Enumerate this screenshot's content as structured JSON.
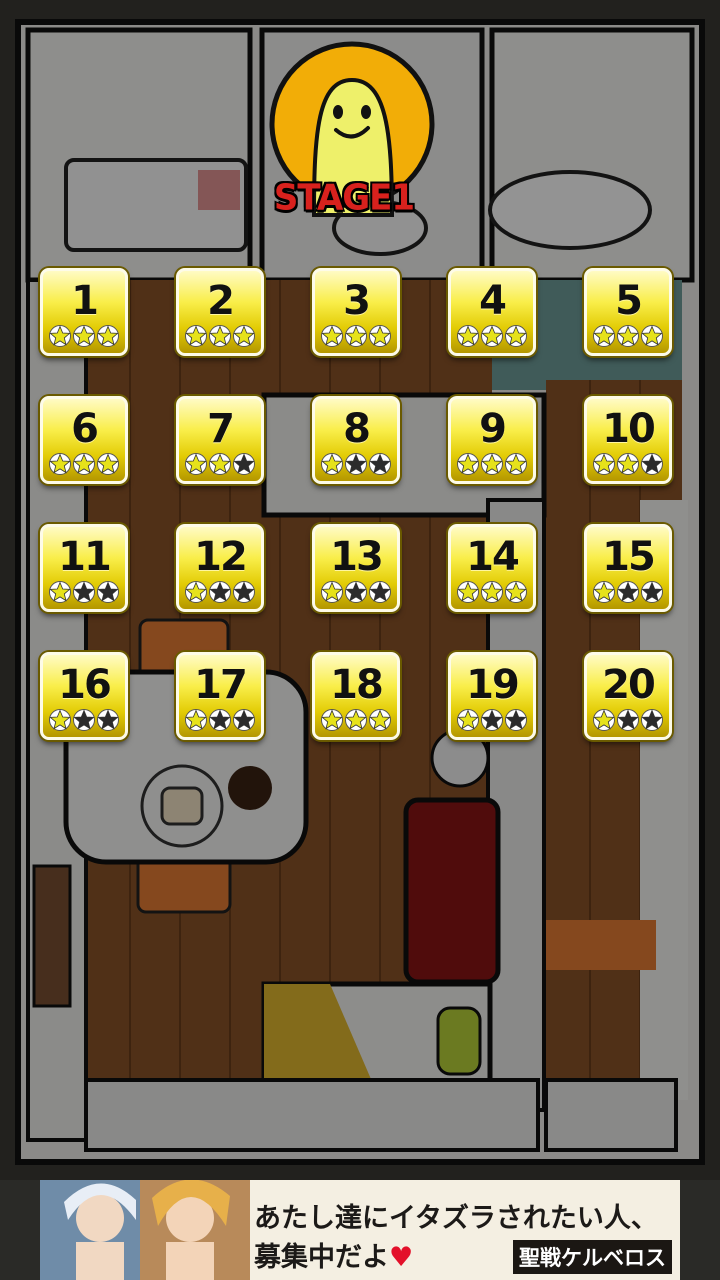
{
  "stage": {
    "label": "STAGE1"
  },
  "levels": [
    {
      "label": "1",
      "stars": 3
    },
    {
      "label": "2",
      "stars": 3
    },
    {
      "label": "3",
      "stars": 3
    },
    {
      "label": "4",
      "stars": 3
    },
    {
      "label": "5",
      "stars": 3
    },
    {
      "label": "6",
      "stars": 3
    },
    {
      "label": "7",
      "stars": 2
    },
    {
      "label": "8",
      "stars": 1
    },
    {
      "label": "9",
      "stars": 3
    },
    {
      "label": "10",
      "stars": 2
    },
    {
      "label": "11",
      "stars": 1
    },
    {
      "label": "12",
      "stars": 1
    },
    {
      "label": "13",
      "stars": 1
    },
    {
      "label": "14",
      "stars": 3
    },
    {
      "label": "15",
      "stars": 1
    },
    {
      "label": "16",
      "stars": 1
    },
    {
      "label": "17",
      "stars": 1
    },
    {
      "label": "18",
      "stars": 3
    },
    {
      "label": "19",
      "stars": 1
    },
    {
      "label": "20",
      "stars": 1
    }
  ],
  "star_colors": {
    "earned": "#e6e21a",
    "empty": "#2b2b2b"
  },
  "ad": {
    "line1": "あたし達にイタズラされたい人、",
    "line2": "募集中だよ",
    "heart": "♥",
    "title": "聖戦ケルベロス"
  }
}
